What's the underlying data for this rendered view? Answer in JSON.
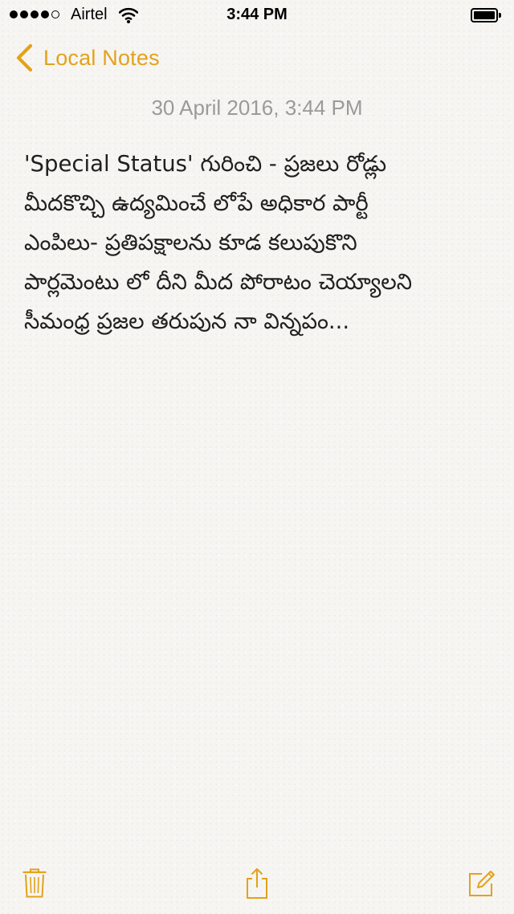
{
  "status_bar": {
    "carrier": "Airtel",
    "time": "3:44 PM",
    "signal_bars_filled": 4,
    "signal_bars_total": 5,
    "icons": [
      "signal-dots-icon",
      "wifi-icon",
      "battery-icon"
    ]
  },
  "nav": {
    "back_label": "Local Notes",
    "back_icon": "chevron-left-icon"
  },
  "note": {
    "date": "30 April 2016, 3:44 PM",
    "lines": [
      "'Special Status' గురించి - ప్రజలు రోడ్లు",
      "మీదకొచ్చి ఉద్యమించే లోపే అధికార పార్టీ",
      "ఎంపిలు- ప్రతిపక్షాలను కూడ కలుపుకొని",
      "పార్లమెంటు లో దీని మీద పోరాటం చెయ్యాలని",
      "సీమంధ్ర  ప్రజల తరుపున నా విన్నపం..."
    ]
  },
  "toolbar": {
    "icons": [
      "trash-icon",
      "share-icon",
      "compose-icon"
    ]
  },
  "colors": {
    "accent": "#e3a21a",
    "date_text": "#9a9a9a",
    "body_text": "#202020",
    "paper": "#f6f5f2"
  }
}
